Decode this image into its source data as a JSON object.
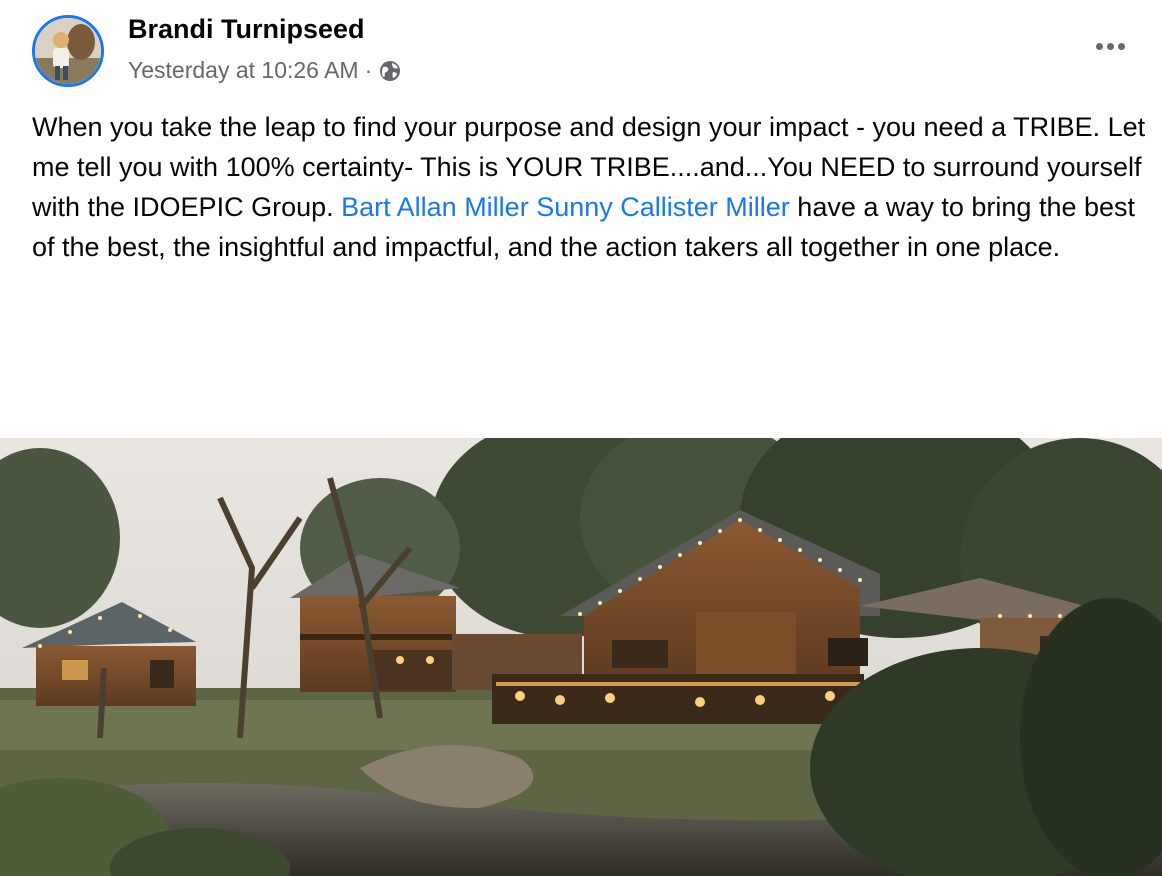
{
  "post": {
    "author": "Brandi Turnipseed",
    "timestamp": "Yesterday at 10:26 AM",
    "separator": "·",
    "privacy_icon": "globe-icon",
    "more_icon": "ellipsis-icon",
    "text_parts": {
      "part1": "When you take the leap to find your purpose and design your impact - you need a TRIBE.  Let me tell you with 100% certainty- This is YOUR TRIBE....and...You NEED to surround yourself with the IDOEPIC Group. ",
      "mention1": "Bart Allan Miller",
      "space": " ",
      "mention2": "Sunny Callister Miller",
      "part2": " have a way to bring the best of the best, the insightful and impactful, and the action takers all together in one place."
    }
  },
  "colors": {
    "link": "#1877f2",
    "secondary_text": "#65676b",
    "primary_text": "#050505",
    "avatar_ring": "#1877f2"
  }
}
